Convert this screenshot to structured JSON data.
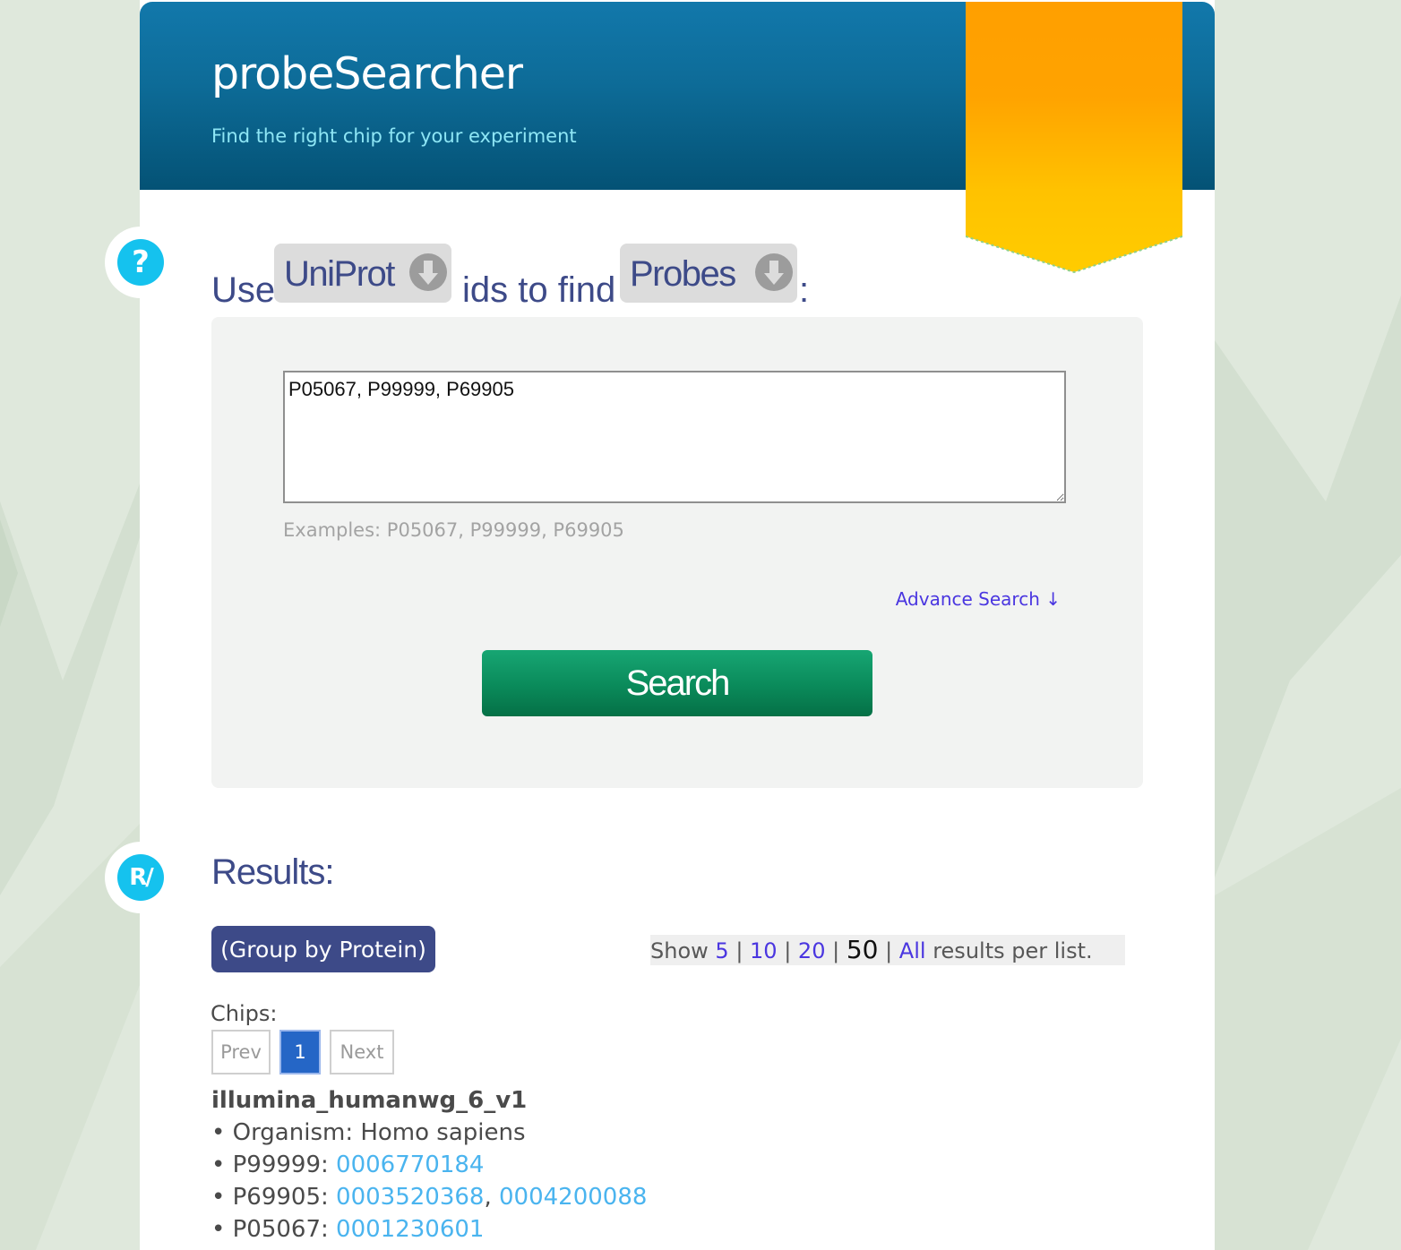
{
  "header": {
    "title": "probeSearcher",
    "subtitle": "Find the right chip for your experiment"
  },
  "query": {
    "prefix": "Use",
    "source_type": "UniProt",
    "middle": "ids to find",
    "target_type": "Probes",
    "suffix": ":"
  },
  "search": {
    "input_value": "P05067, P99999, P69905",
    "examples": "Examples: P05067, P99999, P69905",
    "advance_label": "Advance Search ↓",
    "button_label": "Search"
  },
  "results": {
    "title": "Results:",
    "group_button": "(Group by Protein)",
    "show_prefix": "Show",
    "options": [
      "5",
      "10",
      "20",
      "50",
      "All"
    ],
    "selected_option": "50",
    "show_suffix": "results per list."
  },
  "chips": {
    "label": "Chips:",
    "pager": {
      "prev": "Prev",
      "current": "1",
      "next": "Next"
    },
    "items": [
      {
        "name": "illumina_humanwg_6_v1",
        "organism_label": "Organism:",
        "organism": "Homo sapiens",
        "proteins": [
          {
            "id": "P99999",
            "probes": [
              "0006770184"
            ]
          },
          {
            "id": "P69905",
            "probes": [
              "0003520368",
              "0004200088"
            ]
          },
          {
            "id": "P05067",
            "probes": [
              "0001230601"
            ]
          }
        ]
      }
    ]
  },
  "icons": {
    "help": "question-mark-icon",
    "results": "results-icon",
    "dropdown": "circle-arrow-down-icon",
    "ribbon": "ribbon-bookmark"
  },
  "colors": {
    "header_top": "#1278ab",
    "header_bottom": "#045275",
    "accent_text": "#3d4a88",
    "search_button": "#0a8a5a",
    "link": "#4a36e0",
    "probe_link": "#4ab4ef",
    "ribbon": "#ffb300",
    "icon_cyan": "#15c2ee"
  }
}
